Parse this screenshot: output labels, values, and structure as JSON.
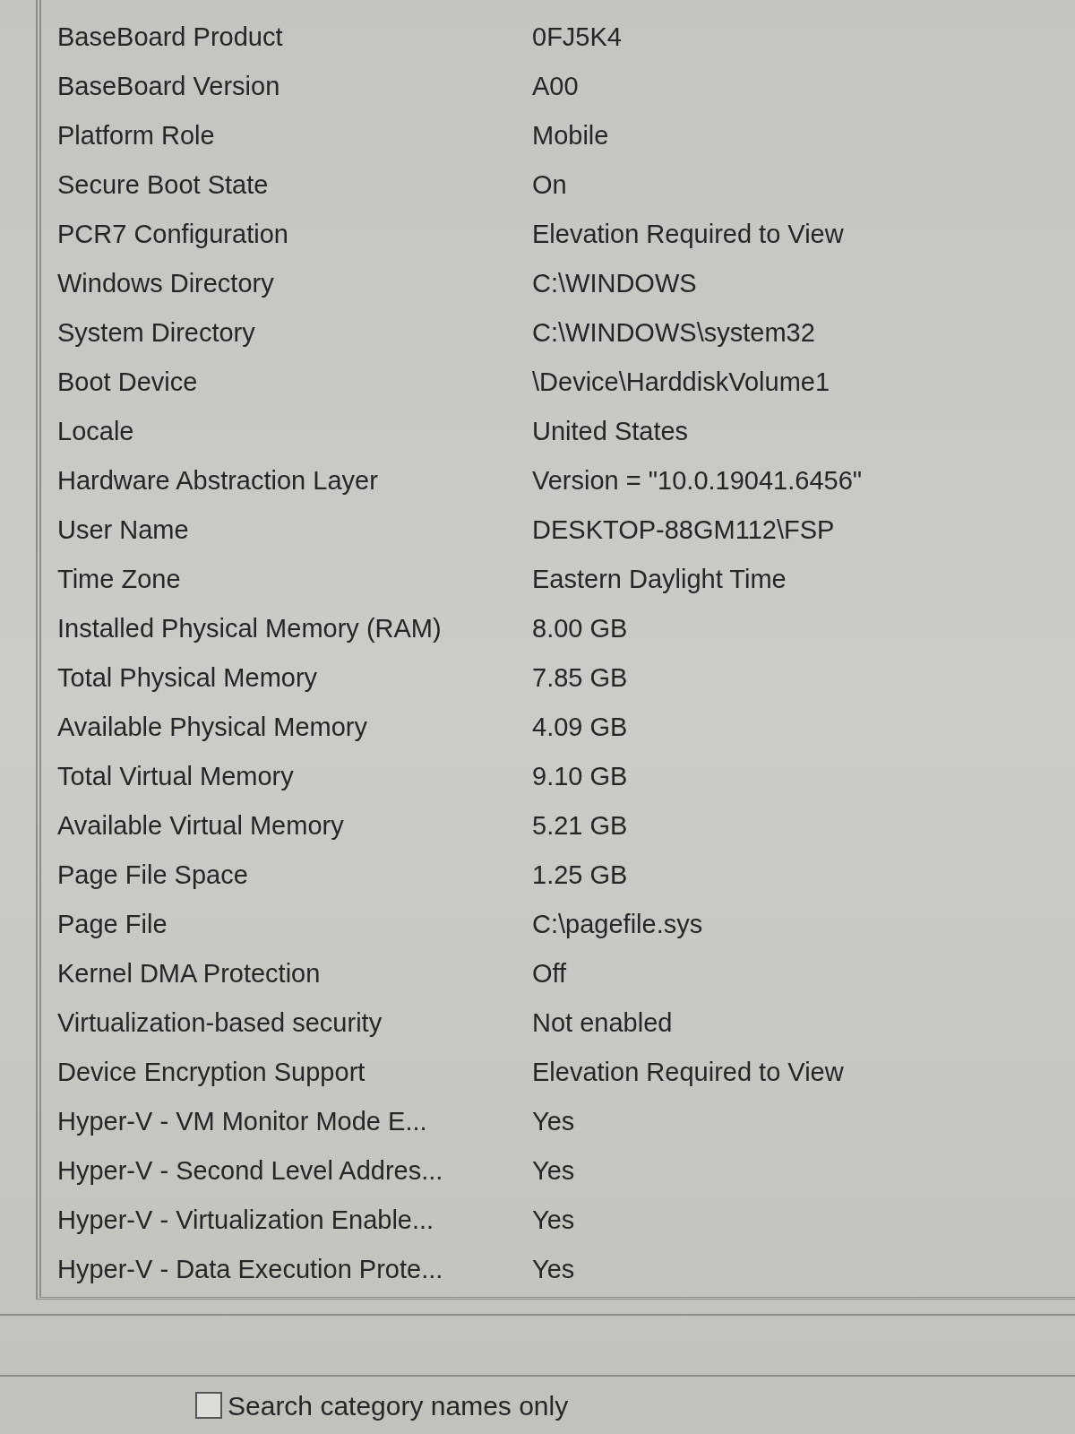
{
  "summary_table": {
    "rows": [
      {
        "item": "BaseBoard Product",
        "value": "0FJ5K4"
      },
      {
        "item": "BaseBoard Version",
        "value": "A00"
      },
      {
        "item": "Platform Role",
        "value": "Mobile"
      },
      {
        "item": "Secure Boot State",
        "value": "On"
      },
      {
        "item": "PCR7 Configuration",
        "value": "Elevation Required to View"
      },
      {
        "item": "Windows Directory",
        "value": "C:\\WINDOWS"
      },
      {
        "item": "System Directory",
        "value": "C:\\WINDOWS\\system32"
      },
      {
        "item": "Boot Device",
        "value": "\\Device\\HarddiskVolume1"
      },
      {
        "item": "Locale",
        "value": "United States"
      },
      {
        "item": "Hardware Abstraction Layer",
        "value": "Version = \"10.0.19041.6456\""
      },
      {
        "item": "User Name",
        "value": "DESKTOP-88GM112\\FSP"
      },
      {
        "item": "Time Zone",
        "value": "Eastern Daylight Time"
      },
      {
        "item": "Installed Physical Memory (RAM)",
        "value": "8.00 GB"
      },
      {
        "item": "Total Physical Memory",
        "value": "7.85 GB"
      },
      {
        "item": "Available Physical Memory",
        "value": "4.09 GB"
      },
      {
        "item": "Total Virtual Memory",
        "value": "9.10 GB"
      },
      {
        "item": "Available Virtual Memory",
        "value": "5.21 GB"
      },
      {
        "item": "Page File Space",
        "value": "1.25 GB"
      },
      {
        "item": "Page File",
        "value": "C:\\pagefile.sys"
      },
      {
        "item": "Kernel DMA Protection",
        "value": "Off"
      },
      {
        "item": "Virtualization-based security",
        "value": "Not enabled"
      },
      {
        "item": "Device Encryption Support",
        "value": "Elevation Required to View"
      },
      {
        "item": "Hyper-V - VM Monitor Mode E...",
        "value": "Yes"
      },
      {
        "item": "Hyper-V - Second Level Addres...",
        "value": "Yes"
      },
      {
        "item": "Hyper-V - Virtualization Enable...",
        "value": "Yes"
      },
      {
        "item": "Hyper-V - Data Execution Prote...",
        "value": "Yes"
      }
    ]
  },
  "search_options": {
    "category_names_only": {
      "label": "Search category names only",
      "checked": false
    }
  }
}
